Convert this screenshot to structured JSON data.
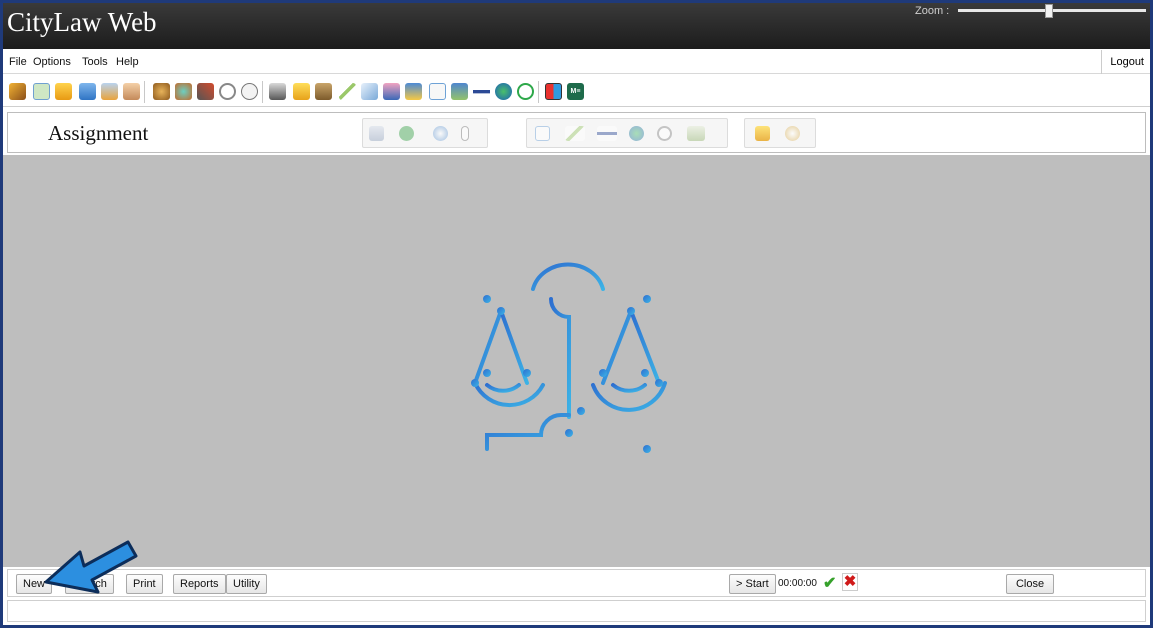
{
  "window": {
    "app_title": "CityLaw Web",
    "zoom_label": "Zoom :",
    "zoom_level": 0.47
  },
  "menu": {
    "items": [
      "File",
      "Options",
      "Tools",
      "Help"
    ],
    "logout": "Logout"
  },
  "toolbar": {
    "icons": [
      "gavel-icon",
      "book-icon",
      "folder-icon",
      "lock-icon",
      "cabinet-icon",
      "handshake-icon",
      "money-bag-icon",
      "ribbon-icon",
      "tools-icon",
      "stopwatch-icon",
      "clock-icon",
      "printer-icon",
      "yellow-folder-icon",
      "board-icon",
      "pen-icon",
      "document-icon",
      "person-icon",
      "notes-icon",
      "preview-icon",
      "contacts-icon",
      "plane-icon",
      "globe-icon",
      "refresh-icon",
      "grid-icon",
      "m-icon"
    ],
    "m_badge_text": "M≡"
  },
  "assignment": {
    "title": "Assignment",
    "groups": [
      [
        "calendar-icon",
        "dollar-icon",
        "recycle-icon",
        "paperclip-icon"
      ],
      [
        "preview-icon",
        "pen-icon",
        "plane-icon",
        "globe-icon",
        "stopwatch-icon",
        "board-icon"
      ],
      [
        "folder-icon",
        "search-icon"
      ]
    ]
  },
  "workspace": {
    "logo": "scales-of-justice-icon"
  },
  "bottom": {
    "new": "New",
    "search": "Search",
    "print": "Print",
    "reports": "Reports",
    "utility": "Utility",
    "start": "> Start",
    "timer": "00:00:00",
    "close": "Close"
  },
  "colors": {
    "accent_blue": "#2f7fd6",
    "arrow_blue": "#2c8fe0",
    "frame": "#1f3a7a"
  }
}
